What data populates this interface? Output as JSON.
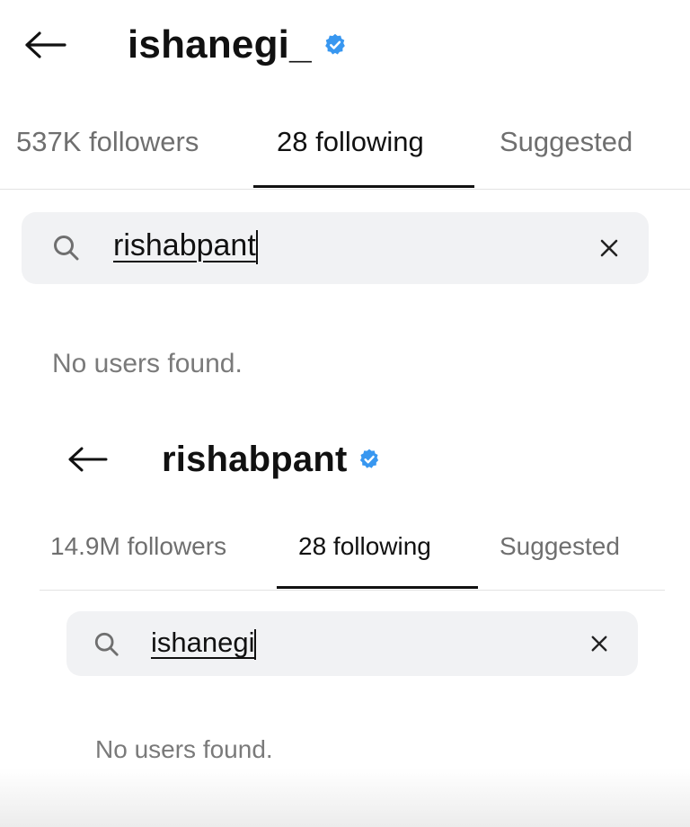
{
  "screens": [
    {
      "username": "ishanegi_",
      "tabs": {
        "followers": "537K followers",
        "following": "28 following",
        "suggested": "Suggested"
      },
      "search": {
        "query": "rishabpant"
      },
      "empty_message": "No users found."
    },
    {
      "username": "rishabpant",
      "tabs": {
        "followers": "14.9M followers",
        "following": "28 following",
        "suggested": "Suggested"
      },
      "search": {
        "query": "ishanegi"
      },
      "empty_message": "No users found."
    }
  ],
  "colors": {
    "verified_badge": "#3897f0",
    "search_bg": "#f1f2f4",
    "muted_text": "#6f6f6f",
    "active_tab": "#111111"
  },
  "icons": [
    "back-arrow-icon",
    "verified-badge-icon",
    "search-icon",
    "clear-icon"
  ]
}
